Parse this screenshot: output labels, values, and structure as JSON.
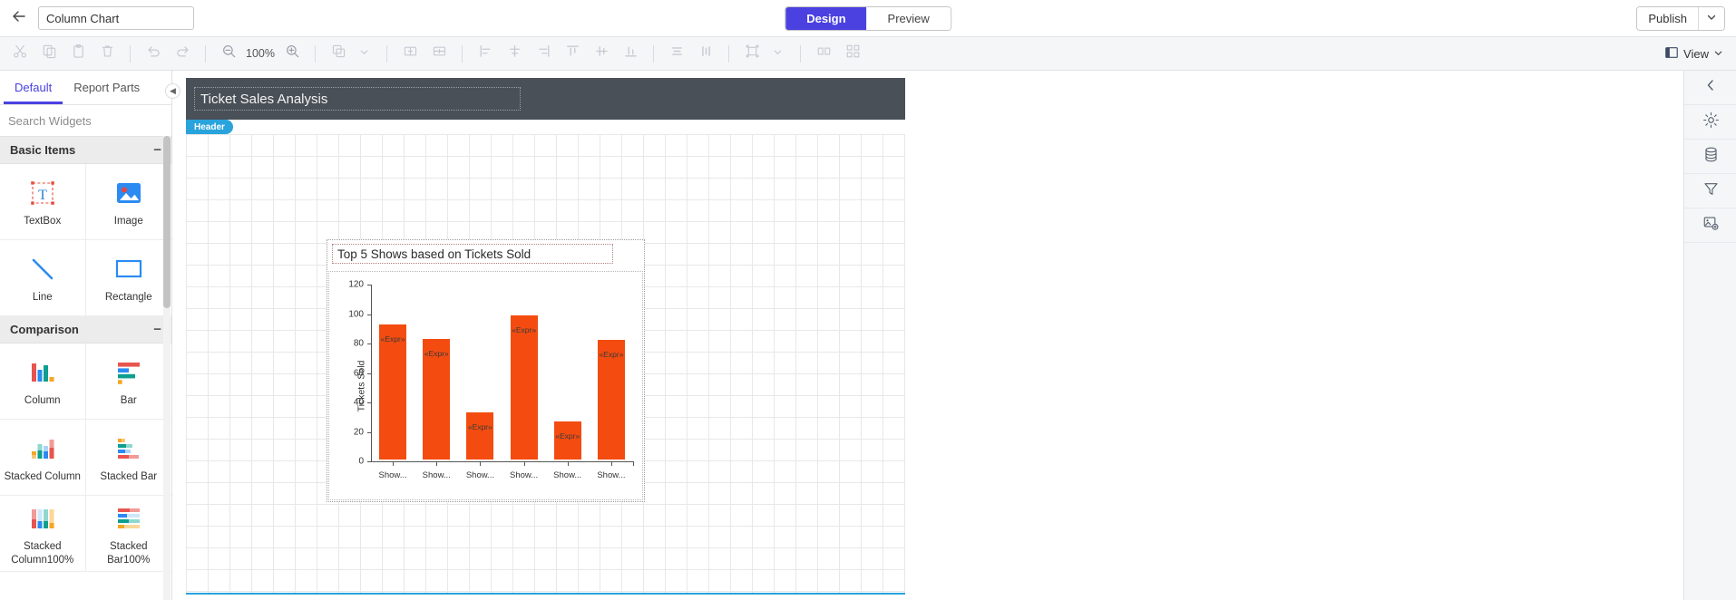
{
  "topbar": {
    "back_icon": "arrow-left-icon",
    "report_name_value": "Column Chart",
    "report_name_placeholder": "Report Name",
    "mode_tabs": [
      {
        "label": "Design",
        "active": true
      },
      {
        "label": "Preview",
        "active": false
      }
    ],
    "publish_label": "Publish",
    "publish_caret_icon": "chevron-down-icon"
  },
  "toolbar": {
    "cut_label": "Cut",
    "copy_label": "Copy",
    "paste_label": "Paste",
    "delete_label": "Delete",
    "undo_label": "Undo",
    "redo_label": "Redo",
    "zoom_out_label": "Zoom Out",
    "zoom_level": "100%",
    "zoom_in_label": "Zoom In",
    "layer_label": "Bring Forward",
    "split_h_label": "Split Horizontal",
    "split_v_label": "Split Vertical",
    "align_left_label": "Align Left",
    "align_center_label": "Align Center",
    "align_right_label": "Align Right",
    "align_top_label": "Align Top",
    "align_middle_label": "Align Middle",
    "align_bottom_label": "Align Bottom",
    "distribute_h_label": "Distribute Horizontally",
    "distribute_v_label": "Distribute Vertically",
    "group_label": "Group",
    "ungroup_label": "Ungroup",
    "view_label": "View"
  },
  "left_panel": {
    "tabs": [
      {
        "label": "Default",
        "active": true
      },
      {
        "label": "Report Parts",
        "active": false
      }
    ],
    "search_placeholder": "Search Widgets",
    "search_value": "",
    "groups": [
      {
        "title": "Basic Items",
        "collapse_glyph": "−",
        "widgets": [
          {
            "label": "TextBox",
            "icon": "textbox-widget-icon"
          },
          {
            "label": "Image",
            "icon": "image-widget-icon"
          },
          {
            "label": "Line",
            "icon": "line-widget-icon"
          },
          {
            "label": "Rectangle",
            "icon": "rectangle-widget-icon"
          }
        ]
      },
      {
        "title": "Comparison",
        "collapse_glyph": "−",
        "widgets": [
          {
            "label": "Column",
            "icon": "column-chart-icon"
          },
          {
            "label": "Bar",
            "icon": "bar-chart-icon"
          },
          {
            "label": "Stacked Column",
            "icon": "stacked-column-chart-icon"
          },
          {
            "label": "Stacked Bar",
            "icon": "stacked-bar-chart-icon"
          },
          {
            "label": "Stacked Column100%",
            "icon": "stacked-column-100-chart-icon"
          },
          {
            "label": "Stacked Bar100%",
            "icon": "stacked-bar-100-chart-icon"
          }
        ]
      }
    ]
  },
  "canvas": {
    "header_title": "Ticket Sales Analysis",
    "header_band_tag": "Header"
  },
  "right_rail": {
    "items": [
      {
        "icon": "chevron-left-icon",
        "label": "Collapse Panel"
      },
      {
        "icon": "gear-icon",
        "label": "Properties"
      },
      {
        "icon": "database-icon",
        "label": "Data"
      },
      {
        "icon": "filter-icon",
        "label": "Filter"
      },
      {
        "icon": "image-settings-icon",
        "label": "Resources"
      }
    ]
  },
  "chart_data": {
    "type": "bar",
    "title": "Top 5 Shows based on Tickets Sold",
    "xlabel": "",
    "ylabel": "Tickets Sold",
    "ylim": [
      0,
      120
    ],
    "yticks": [
      0,
      20,
      40,
      60,
      80,
      100,
      120
    ],
    "grid": false,
    "legend": "none",
    "bar_color": "#f44c10",
    "categories": [
      "Show...",
      "Show...",
      "Show...",
      "Show...",
      "Show...",
      "Show..."
    ],
    "values": [
      92,
      82,
      32,
      98,
      26,
      81
    ],
    "data_labels": [
      "«Expr»",
      "«Expr»",
      "«Expr»",
      "«Expr»",
      "«Expr»",
      "«Expr»"
    ]
  }
}
